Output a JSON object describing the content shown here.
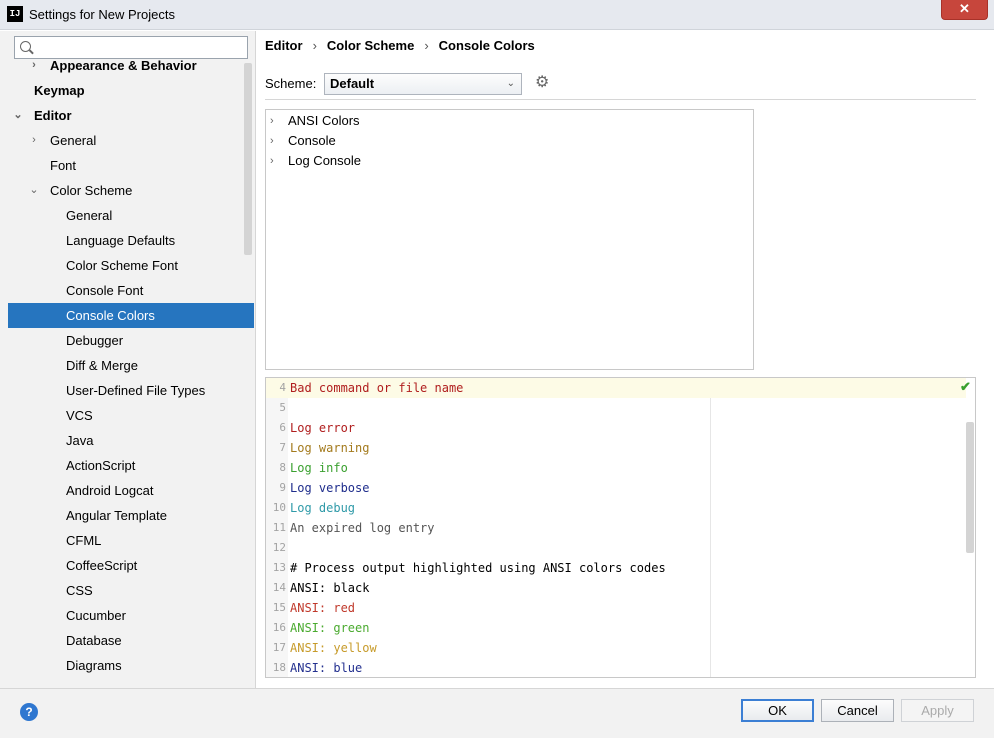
{
  "window": {
    "title": "Settings for New Projects",
    "close_glyph": "✕"
  },
  "sidebar": {
    "search": {
      "value": "",
      "placeholder": ""
    },
    "items": [
      {
        "label": "Appearance & Behavior",
        "bold": true,
        "expander": "›"
      },
      {
        "label": "Keymap",
        "bold": true
      },
      {
        "label": "Editor",
        "bold": true,
        "expander": "⌄"
      },
      {
        "label": "General",
        "expander": "›"
      },
      {
        "label": "Font"
      },
      {
        "label": "Color Scheme",
        "expander": "⌄"
      },
      {
        "label": "General"
      },
      {
        "label": "Language Defaults"
      },
      {
        "label": "Color Scheme Font"
      },
      {
        "label": "Console Font"
      },
      {
        "label": "Console Colors",
        "selected": true
      },
      {
        "label": "Debugger"
      },
      {
        "label": "Diff & Merge"
      },
      {
        "label": "User-Defined File Types"
      },
      {
        "label": "VCS"
      },
      {
        "label": "Java"
      },
      {
        "label": "ActionScript"
      },
      {
        "label": "Android Logcat"
      },
      {
        "label": "Angular Template"
      },
      {
        "label": "CFML"
      },
      {
        "label": "CoffeeScript"
      },
      {
        "label": "CSS"
      },
      {
        "label": "Cucumber"
      },
      {
        "label": "Database"
      },
      {
        "label": "Diagrams"
      }
    ]
  },
  "breadcrumb": [
    "Editor",
    "Color Scheme",
    "Console Colors"
  ],
  "scheme": {
    "label": "Scheme:",
    "value": "Default"
  },
  "categories": [
    {
      "label": "ANSI Colors"
    },
    {
      "label": "Console"
    },
    {
      "label": "Log Console"
    }
  ],
  "preview": {
    "lines": [
      {
        "num": "4",
        "parts": [
          {
            "text": "Bad command or file name",
            "color": "#b01e1e"
          }
        ],
        "highlight": true
      },
      {
        "num": "5",
        "parts": []
      },
      {
        "num": "6",
        "parts": [
          {
            "text": "Log error",
            "color": "#b01e1e"
          }
        ]
      },
      {
        "num": "7",
        "parts": [
          {
            "text": "Log warning",
            "color": "#a37a1d"
          }
        ]
      },
      {
        "num": "8",
        "parts": [
          {
            "text": "Log info",
            "color": "#3aa02f"
          }
        ]
      },
      {
        "num": "9",
        "parts": [
          {
            "text": "Log verbose",
            "color": "#1f2d8c"
          }
        ]
      },
      {
        "num": "10",
        "parts": [
          {
            "text": "Log debug",
            "color": "#2f9aa8"
          }
        ]
      },
      {
        "num": "11",
        "parts": [
          {
            "text": "An expired log entry",
            "color": "#555555"
          }
        ]
      },
      {
        "num": "12",
        "parts": []
      },
      {
        "num": "13",
        "parts": [
          {
            "text": "# Process output highlighted using ANSI colors codes",
            "color": "#000000"
          }
        ]
      },
      {
        "num": "14",
        "parts": [
          {
            "text": "ANSI: ",
            "color": "#000000"
          },
          {
            "text": "black",
            "color": "#000000"
          }
        ]
      },
      {
        "num": "15",
        "parts": [
          {
            "text": "ANSI: ",
            "color": "#c0392b"
          },
          {
            "text": "red",
            "color": "#c0392b"
          }
        ]
      },
      {
        "num": "16",
        "parts": [
          {
            "text": "ANSI: ",
            "color": "#4aaa2f"
          },
          {
            "text": "green",
            "color": "#4aaa2f"
          }
        ]
      },
      {
        "num": "17",
        "parts": [
          {
            "text": "ANSI: ",
            "color": "#c79b2a"
          },
          {
            "text": "yellow",
            "color": "#c79b2a"
          }
        ]
      },
      {
        "num": "18",
        "parts": [
          {
            "text": "ANSI: ",
            "color": "#23308f"
          },
          {
            "text": "blue",
            "color": "#23308f"
          }
        ]
      }
    ]
  },
  "footer": {
    "help": "?",
    "ok": "OK",
    "cancel": "Cancel",
    "apply": "Apply"
  }
}
